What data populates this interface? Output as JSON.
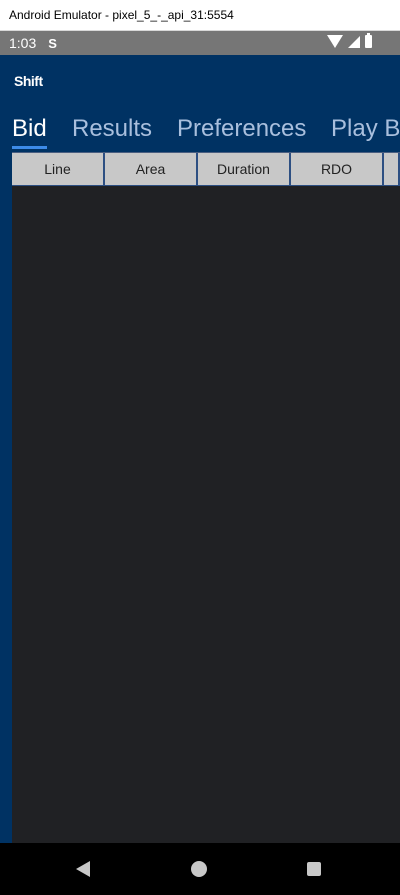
{
  "window": {
    "title": "Android Emulator - pixel_5_-_api_31:5554"
  },
  "status_bar": {
    "time": "1:03",
    "sync_glyph": "S"
  },
  "app": {
    "logo": "Shift"
  },
  "tabs": [
    {
      "label": "Bid",
      "active": true
    },
    {
      "label": "Results",
      "active": false
    },
    {
      "label": "Preferences",
      "active": false
    },
    {
      "label": "Play By",
      "active": false
    }
  ],
  "grid": {
    "columns": [
      "Line",
      "Area",
      "Duration",
      "RDO",
      ""
    ]
  },
  "colors": {
    "app_bg": "#003263",
    "content_bg": "#202124",
    "tab_active": "#ffffff",
    "tab_inactive": "#a9bfdd",
    "indicator": "#3d8be8"
  }
}
